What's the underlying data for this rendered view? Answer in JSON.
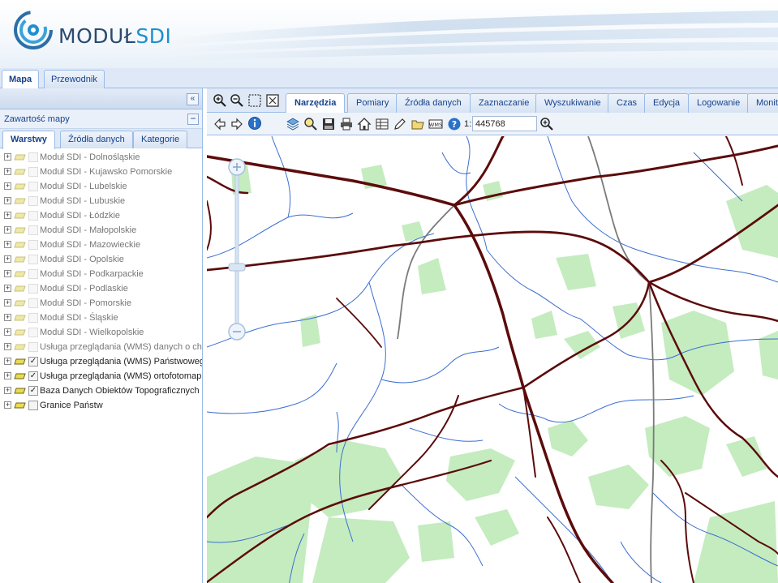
{
  "app": {
    "logo_text_a": "MODUŁ",
    "logo_text_b": "SDI",
    "brand_color": "#1d8fd0",
    "brand_dark": "#2c4a6e"
  },
  "top_tabs": [
    {
      "label": "Mapa",
      "active": true
    },
    {
      "label": "Przewodnik",
      "active": false
    }
  ],
  "left_panel": {
    "collapse_icon": "double-chevron-left-icon",
    "title": "Zawartość mapy",
    "minimize_icon": "minus-icon",
    "tabs": [
      {
        "label": "Warstwy",
        "active": true
      },
      {
        "label": "Źródła danych",
        "active": false
      },
      {
        "label": "Kategorie",
        "active": false
      }
    ],
    "layers": [
      {
        "label": "Moduł SDI - Dolnośląskie",
        "checked": false,
        "enabled": false
      },
      {
        "label": "Moduł SDI - Kujawsko Pomorskie",
        "checked": false,
        "enabled": false
      },
      {
        "label": "Moduł SDI - Lubelskie",
        "checked": false,
        "enabled": false
      },
      {
        "label": "Moduł SDI - Lubuskie",
        "checked": false,
        "enabled": false
      },
      {
        "label": "Moduł SDI - Łódzkie",
        "checked": false,
        "enabled": false
      },
      {
        "label": "Moduł SDI - Małopolskie",
        "checked": false,
        "enabled": false
      },
      {
        "label": "Moduł SDI - Mazowieckie",
        "checked": false,
        "enabled": false
      },
      {
        "label": "Moduł SDI - Opolskie",
        "checked": false,
        "enabled": false
      },
      {
        "label": "Moduł SDI - Podkarpackie",
        "checked": false,
        "enabled": false
      },
      {
        "label": "Moduł SDI - Podlaskie",
        "checked": false,
        "enabled": false
      },
      {
        "label": "Moduł SDI - Pomorskie",
        "checked": false,
        "enabled": false
      },
      {
        "label": "Moduł SDI - Śląskie",
        "checked": false,
        "enabled": false
      },
      {
        "label": "Moduł SDI - Wielkopolskie",
        "checked": false,
        "enabled": false
      },
      {
        "label": "Usługa przeglądania (WMS) danych o ch",
        "checked": false,
        "enabled": false
      },
      {
        "label": "Usługa przeglądania (WMS) Państwowego",
        "checked": true,
        "enabled": true
      },
      {
        "label": "Usługa przeglądania (WMS) ortofotomap",
        "checked": true,
        "enabled": true
      },
      {
        "label": "Baza Danych Obiektów Topograficznych",
        "checked": true,
        "enabled": true
      },
      {
        "label": "Granice Państw",
        "checked": false,
        "enabled": true
      }
    ]
  },
  "map_toolbar": {
    "tabs": [
      {
        "label": "Narzędzia",
        "active": true
      },
      {
        "label": "Pomiary",
        "active": false
      },
      {
        "label": "Źródła danych",
        "active": false
      },
      {
        "label": "Zaznaczanie",
        "active": false
      },
      {
        "label": "Wyszukiwanie",
        "active": false
      },
      {
        "label": "Czas",
        "active": false
      },
      {
        "label": "Edycja",
        "active": false
      },
      {
        "label": "Logowanie",
        "active": false
      },
      {
        "label": "Monito",
        "active": false
      }
    ],
    "scale_prefix": "1:",
    "scale_value": "445768"
  },
  "map": {
    "road_color": "#5c0b0b",
    "river_color": "#3b6fd1",
    "forest_color": "#c4ecbf",
    "rail_color": "#7a7a7a"
  }
}
